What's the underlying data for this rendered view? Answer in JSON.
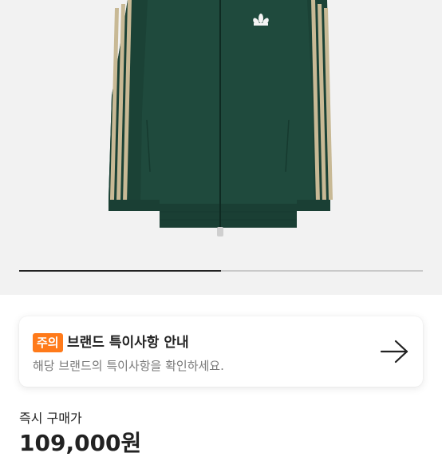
{
  "product_image": {
    "alt": "",
    "carousel_progress": 0.5
  },
  "notice": {
    "badge": "주의",
    "title": "브랜드 특이사항 안내",
    "description": "해당 브랜드의 특이사항을 확인하세요.",
    "arrow_icon": "arrow-right-icon"
  },
  "price": {
    "label": "즉시 구매가",
    "value": "109,000원"
  },
  "colors": {
    "accent_badge": "#ff7a1a",
    "jacket_green": "#1f4a3d",
    "stripe_beige": "#c8b995"
  }
}
